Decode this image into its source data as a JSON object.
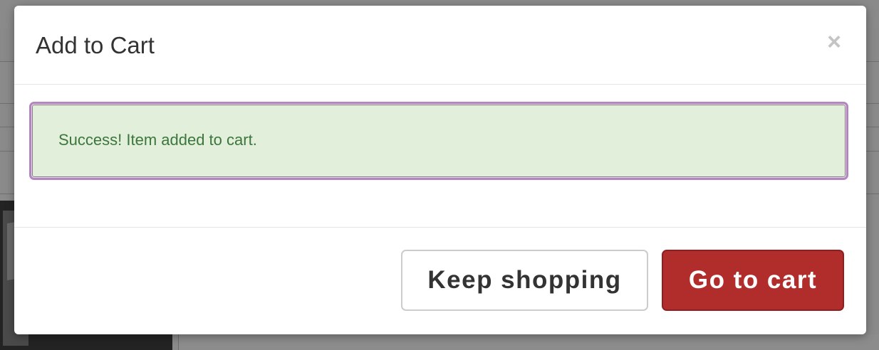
{
  "modal": {
    "title": "Add to Cart",
    "close_glyph": "×",
    "alert_message": "Success! Item added to cart.",
    "buttons": {
      "keep_shopping": "Keep shopping",
      "go_to_cart": "Go to cart"
    }
  },
  "colors": {
    "primary_button": "#b12d2c",
    "alert_background": "#e2efda",
    "alert_text": "#3c763d",
    "focus_outline": "#b385c0"
  },
  "icons": {
    "close": "close-icon"
  }
}
